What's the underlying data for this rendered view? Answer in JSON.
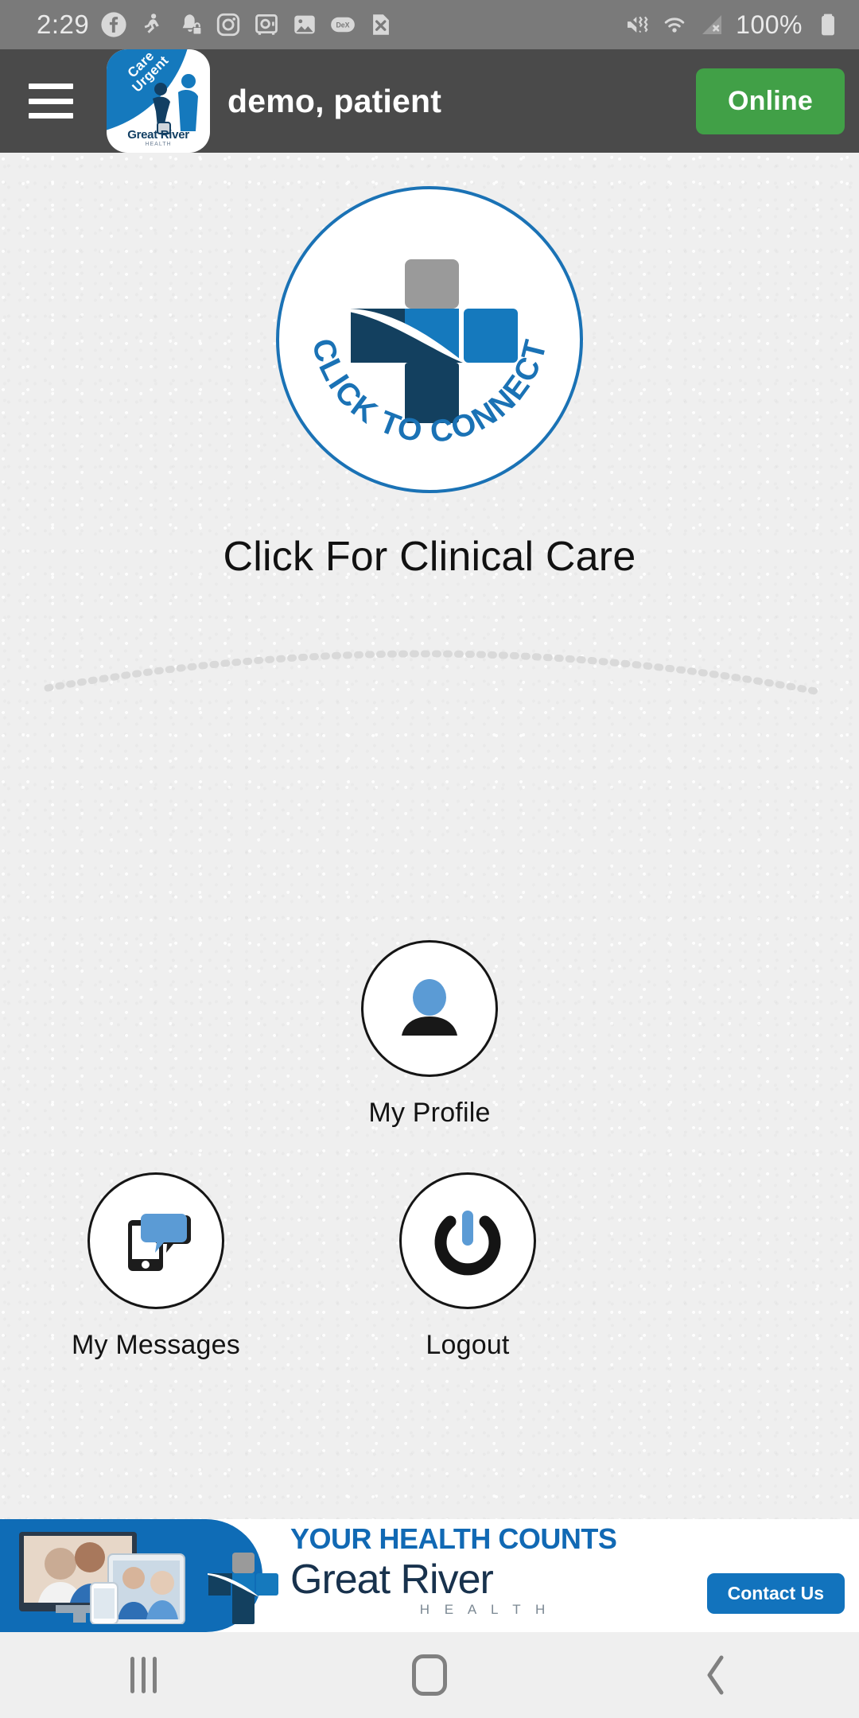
{
  "statusbar": {
    "time": "2:29",
    "battery_percent": "100%",
    "left_icons": [
      {
        "name": "facebook-icon"
      },
      {
        "name": "strava-run-icon"
      },
      {
        "name": "bell-lock-icon"
      },
      {
        "name": "instagram-icon"
      },
      {
        "name": "secure-folder-icon"
      },
      {
        "name": "gallery-image-icon"
      },
      {
        "name": "dex-icon",
        "label": "DeX"
      },
      {
        "name": "file-close-icon"
      }
    ],
    "right_icons": [
      {
        "name": "mute-vibrate-icon"
      },
      {
        "name": "wifi-icon"
      },
      {
        "name": "cellular-no-service-icon"
      },
      {
        "name": "battery-full-icon"
      }
    ]
  },
  "appbar": {
    "menu_label": "menu",
    "logo": {
      "banner_line1": "Care",
      "banner_line2": "Urgent",
      "brand": "Great River",
      "brand_sub": "HEALTH"
    },
    "title": "demo, patient",
    "status_button": "Online",
    "status_color": "#41a047"
  },
  "main": {
    "connect_logo": {
      "arc_text": "CLICK TO CONNECT",
      "colors": {
        "ring": "#1a72b5",
        "cross_top": "#9a9a9a",
        "cross_right": "#1579bd",
        "cross_dark": "#13405f"
      }
    },
    "headline": "Click For Clinical Care",
    "tiles": [
      {
        "name": "my-profile",
        "label": "My Profile",
        "icon": "person-icon"
      },
      {
        "name": "my-messages",
        "label": "My Messages",
        "icon": "phone-chat-icon"
      },
      {
        "name": "logout",
        "label": "Logout",
        "icon": "power-icon"
      }
    ]
  },
  "banner": {
    "headline": "YOUR HEALTH COUNTS",
    "brand": "Great River",
    "brand_sub": "H E A L T H",
    "cta": "Contact Us",
    "accent": "#1169b4"
  },
  "navbar": {
    "recents_label": "Recents",
    "home_label": "Home",
    "back_label": "Back"
  }
}
